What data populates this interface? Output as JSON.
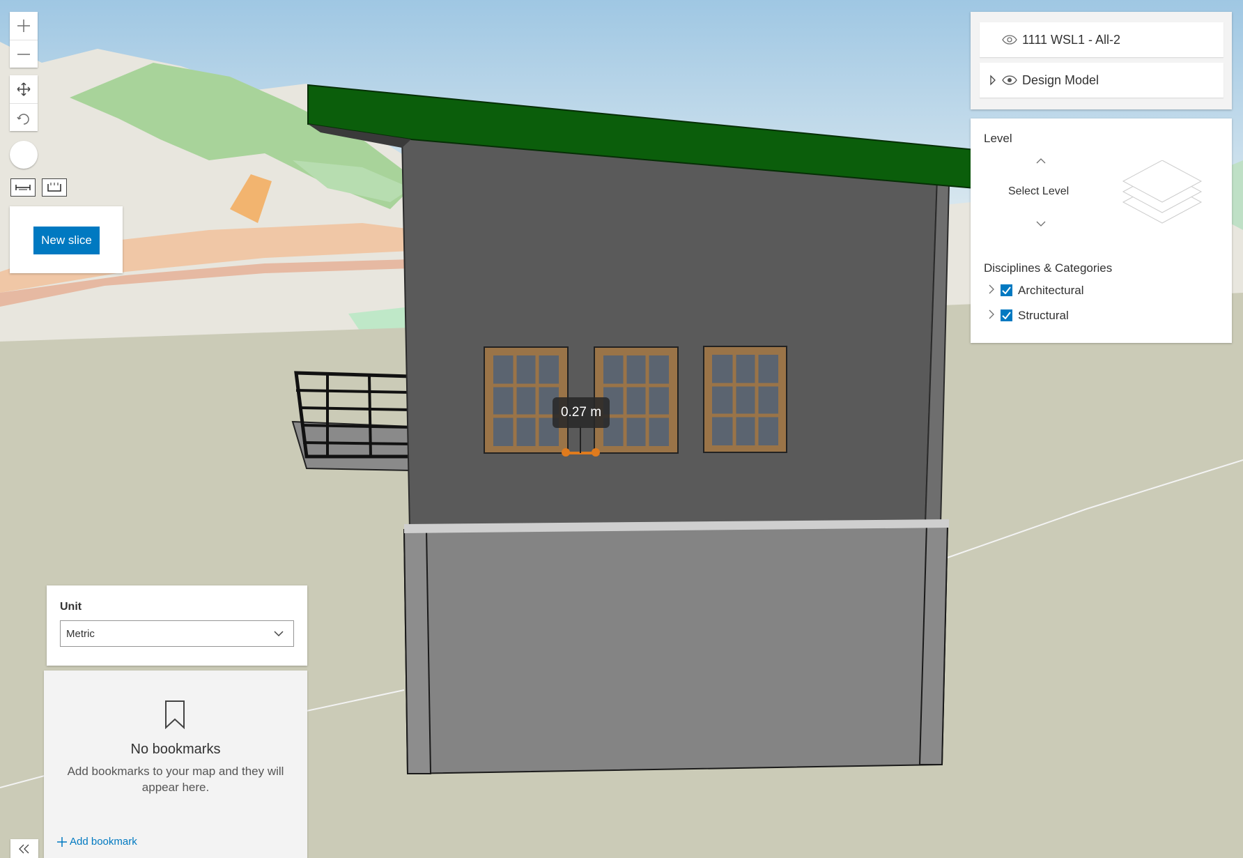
{
  "layer_list": {
    "items": [
      {
        "label": "1111 WSL1 - All-2",
        "icon": "eye-icon"
      },
      {
        "label": "Design Model",
        "icon": "eye-icon",
        "expand_icon": "caret-right-icon"
      }
    ]
  },
  "filter": {
    "level_title": "Level",
    "select_level": "Select Level",
    "disciplines_title": "Disciplines & Categories",
    "categories": [
      {
        "label": "Architectural",
        "checked": true
      },
      {
        "label": "Structural",
        "checked": true
      }
    ]
  },
  "slice": {
    "button_label": "New slice"
  },
  "measurement": {
    "value_label": "0.27 m"
  },
  "unit": {
    "title": "Unit",
    "selected": "Metric"
  },
  "bookmarks": {
    "empty_title": "No bookmarks",
    "empty_message": "Add bookmarks to your map and they will appear here.",
    "add_label": "Add bookmark"
  },
  "colors": {
    "accent": "#0079c1",
    "roof": "#0b5e0b",
    "wall": "#5a5a5a",
    "base": "#848484"
  }
}
